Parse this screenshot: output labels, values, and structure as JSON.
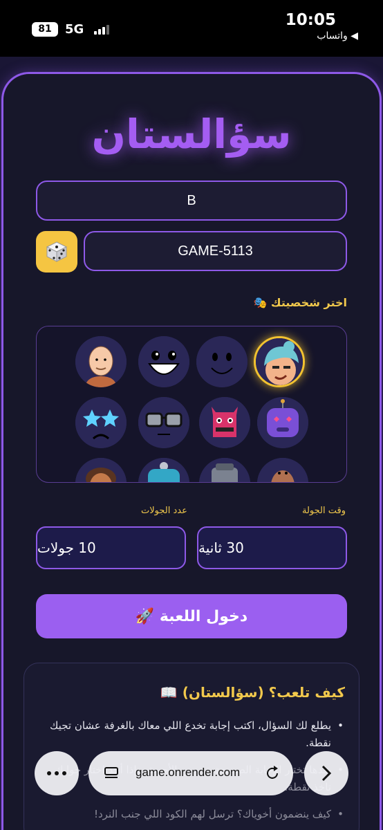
{
  "status_bar": {
    "time": "10:05",
    "back_app": "◀ واتساب",
    "battery": "81",
    "network": "5G"
  },
  "app": {
    "title": "سؤالستان",
    "name_value": "B",
    "room_code_value": "GAME-5113",
    "choose_character_label": "اختر شخصيتك 🎭",
    "round_time_label": "وقت الجولة",
    "round_count_label": "عدد الجولات",
    "round_time_value": "30 ثانية",
    "round_count_value": "10 جولات",
    "enter_button": "دخول اللعبة 🚀"
  },
  "how_to": {
    "title": "كيف تلعب؟ (سؤالستان) 📖",
    "items": [
      "يطلع لك السؤال، اكتب إجابة تخدع اللي معاك بالغرفة عشان تجيك نقطة.",
      "بعدها تختار الإجابة الصحيحة من بين الأجوبة، وإذا أحد اختار جوابك تاخذ نقطة.",
      "كيف ينضمون أخوياك؟ ترسل لهم الكود اللي جنب النرد!"
    ]
  },
  "browser": {
    "url": "game.onrender.com"
  },
  "colors": {
    "accent": "#9b5ff0",
    "gold": "#f2c94c",
    "card_bg": "#17172a"
  }
}
